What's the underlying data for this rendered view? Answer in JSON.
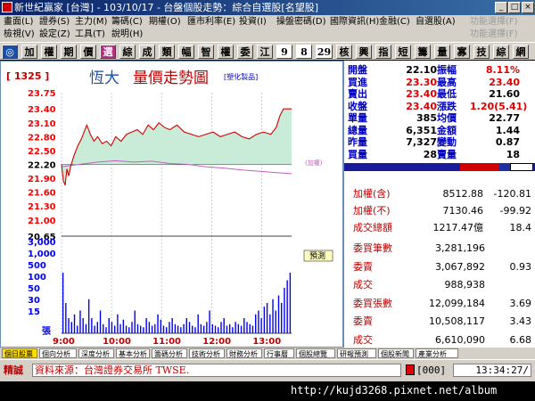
{
  "window": {
    "title": "新世紀贏家 [台灣] - 103/10/17 - 台盤個股走勢：綜合自選股[名望股]",
    "controls": [
      "_",
      "□",
      "×"
    ]
  },
  "menu": {
    "row1": [
      "畫面(L)",
      "證券(S)",
      "主力(M)",
      "籌碼(C)",
      "期權(O)",
      "匯市利率(E)",
      "投資(I)",
      "操盤密碼(D)",
      "國際資訊(H)",
      "金融(C)",
      "自選股(A)",
      "功能選擇(F)"
    ],
    "row2": [
      "檢視(V)",
      "設定(Z)",
      "工具(T)",
      "說明(H)"
    ]
  },
  "toolbar": {
    "buttons": [
      {
        "label": "◎",
        "bg": "#1a4ea8",
        "fg": "#ffffff"
      },
      {
        "label": "加",
        "bg": "#d4d0c8",
        "fg": "#000000"
      },
      {
        "label": "權",
        "bg": "#d4d0c8",
        "fg": "#000000"
      },
      {
        "label": "期",
        "bg": "#d4d0c8",
        "fg": "#000000"
      },
      {
        "label": "價",
        "bg": "#d4d0c8",
        "fg": "#000000"
      },
      {
        "label": "選",
        "bg": "#b03080",
        "fg": "#ffffff"
      },
      {
        "label": "綜",
        "bg": "#d4d0c8",
        "fg": "#000000"
      },
      {
        "label": "成",
        "bg": "#d4d0c8",
        "fg": "#000000"
      },
      {
        "label": "類",
        "bg": "#d4d0c8",
        "fg": "#000000"
      },
      {
        "label": "幅",
        "bg": "#d4d0c8",
        "fg": "#000000"
      },
      {
        "label": "智",
        "bg": "#d4d0c8",
        "fg": "#000000"
      },
      {
        "label": "權",
        "bg": "#d4d0c8",
        "fg": "#000000"
      },
      {
        "label": "委",
        "bg": "#d4d0c8",
        "fg": "#000000"
      },
      {
        "label": "江",
        "bg": "#d4d0c8",
        "fg": "#000000"
      },
      {
        "label": "9",
        "bg": "#ffffff",
        "fg": "#000000"
      },
      {
        "label": "8",
        "bg": "#ffffff",
        "fg": "#000000"
      },
      {
        "label": "29",
        "bg": "#ffffff",
        "fg": "#000000"
      },
      {
        "label": "核",
        "bg": "#d4d0c8",
        "fg": "#000000"
      },
      {
        "label": "興",
        "bg": "#d4d0c8",
        "fg": "#000000"
      },
      {
        "label": "指",
        "bg": "#d4d0c8",
        "fg": "#000000"
      },
      {
        "label": "短",
        "bg": "#d4d0c8",
        "fg": "#000000"
      },
      {
        "label": "籌",
        "bg": "#d4d0c8",
        "fg": "#000000"
      },
      {
        "label": "量",
        "bg": "#d4d0c8",
        "fg": "#000000"
      },
      {
        "label": "寡",
        "bg": "#d4d0c8",
        "fg": "#000000"
      },
      {
        "label": "技",
        "bg": "#d4d0c8",
        "fg": "#000000"
      },
      {
        "label": "綜",
        "bg": "#d4d0c8",
        "fg": "#000000"
      },
      {
        "label": "網",
        "bg": "#d4d0c8",
        "fg": "#000000"
      }
    ]
  },
  "chart_header": {
    "code": "[ 1325 ]",
    "name": "恆大",
    "title": "量價走勢圖",
    "category": "[塑化製品]",
    "note": "(加權)",
    "badge": "預測"
  },
  "chart_data": {
    "type": "line",
    "price_ticks": [
      "23.75",
      "23.40",
      "23.10",
      "22.80",
      "22.50",
      "22.20",
      "21.90",
      "21.60",
      "21.30",
      "21.00",
      "20.65"
    ],
    "volume_ticks": [
      "3,000",
      "1,000",
      "500",
      "100",
      "50",
      "30",
      "15"
    ],
    "volume_unit": "張",
    "time_ticks": [
      "9:00",
      "10:00",
      "11:00",
      "12:00",
      "13:00"
    ],
    "reference_price": 22.2,
    "ylim": [
      20.65,
      23.75
    ],
    "price_series": [
      {
        "t": 0,
        "v": 22.2
      },
      {
        "t": 2,
        "v": 21.85
      },
      {
        "t": 4,
        "v": 21.75
      },
      {
        "t": 6,
        "v": 22.1
      },
      {
        "t": 8,
        "v": 21.95
      },
      {
        "t": 10,
        "v": 22.15
      },
      {
        "t": 14,
        "v": 22.4
      },
      {
        "t": 18,
        "v": 22.6
      },
      {
        "t": 22,
        "v": 22.75
      },
      {
        "t": 25,
        "v": 22.9
      },
      {
        "t": 28,
        "v": 23.05
      },
      {
        "t": 32,
        "v": 22.85
      },
      {
        "t": 36,
        "v": 22.7
      },
      {
        "t": 40,
        "v": 22.8
      },
      {
        "t": 45,
        "v": 22.65
      },
      {
        "t": 50,
        "v": 22.7
      },
      {
        "t": 55,
        "v": 22.6
      },
      {
        "t": 60,
        "v": 22.8
      },
      {
        "t": 66,
        "v": 22.7
      },
      {
        "t": 72,
        "v": 22.85
      },
      {
        "t": 78,
        "v": 22.9
      },
      {
        "t": 84,
        "v": 22.95
      },
      {
        "t": 90,
        "v": 22.85
      },
      {
        "t": 96,
        "v": 23.05
      },
      {
        "t": 102,
        "v": 22.95
      },
      {
        "t": 108,
        "v": 23.1
      },
      {
        "t": 114,
        "v": 23.0
      },
      {
        "t": 120,
        "v": 22.95
      },
      {
        "t": 128,
        "v": 23.05
      },
      {
        "t": 136,
        "v": 22.9
      },
      {
        "t": 144,
        "v": 22.85
      },
      {
        "t": 152,
        "v": 22.8
      },
      {
        "t": 160,
        "v": 22.85
      },
      {
        "t": 168,
        "v": 22.9
      },
      {
        "t": 176,
        "v": 22.8
      },
      {
        "t": 184,
        "v": 22.85
      },
      {
        "t": 192,
        "v": 22.9
      },
      {
        "t": 200,
        "v": 22.8
      },
      {
        "t": 208,
        "v": 22.75
      },
      {
        "t": 216,
        "v": 22.85
      },
      {
        "t": 224,
        "v": 22.9
      },
      {
        "t": 232,
        "v": 22.85
      },
      {
        "t": 238,
        "v": 23.0
      },
      {
        "t": 242,
        "v": 23.25
      },
      {
        "t": 246,
        "v": 23.4
      },
      {
        "t": 255,
        "v": 23.4
      }
    ],
    "index_series": [
      {
        "t": 0,
        "v": 22.15
      },
      {
        "t": 20,
        "v": 22.2
      },
      {
        "t": 40,
        "v": 22.25
      },
      {
        "t": 60,
        "v": 22.28
      },
      {
        "t": 80,
        "v": 22.25
      },
      {
        "t": 100,
        "v": 22.27
      },
      {
        "t": 120,
        "v": 22.22
      },
      {
        "t": 140,
        "v": 22.2
      },
      {
        "t": 160,
        "v": 22.15
      },
      {
        "t": 180,
        "v": 22.12
      },
      {
        "t": 200,
        "v": 22.08
      },
      {
        "t": 220,
        "v": 22.05
      },
      {
        "t": 240,
        "v": 22.02
      },
      {
        "t": 255,
        "v": 22.0
      }
    ],
    "volume_series": [
      80,
      40,
      20,
      15,
      25,
      10,
      30,
      20,
      12,
      45,
      20,
      10,
      15,
      30,
      12,
      8,
      20,
      15,
      10,
      25,
      12,
      18,
      10,
      8,
      15,
      30,
      12,
      10,
      8,
      20,
      15,
      10,
      12,
      25,
      18,
      10,
      8,
      15,
      20,
      12,
      10,
      8,
      12,
      20,
      15,
      10,
      8,
      25,
      12,
      10,
      15,
      30,
      12,
      10,
      8,
      15,
      20,
      10,
      12,
      8,
      15,
      12,
      10,
      20,
      15,
      12,
      10,
      25,
      30,
      20,
      35,
      40,
      25,
      45,
      30,
      50,
      40,
      60,
      70,
      80
    ]
  },
  "quote": {
    "rows": [
      {
        "l1": "開盤",
        "v1": "22.10",
        "l2": "振幅",
        "v2": "8.11%",
        "c1": "#000000",
        "c2": "#e00000"
      },
      {
        "l1": "買進",
        "v1": "23.30",
        "l2": "最高",
        "v2": "23.40",
        "c1": "#e00000",
        "c2": "#e00000"
      },
      {
        "l1": "賣出",
        "v1": "23.40",
        "l2": "最低",
        "v2": "21.60",
        "c1": "#e00000",
        "c2": "#000000"
      },
      {
        "l1": "收盤",
        "v1": "23.40",
        "l2": "漲跌",
        "v2": "1.20(5.41)",
        "c1": "#e00000",
        "c2": "#e00000"
      },
      {
        "l1": "單量",
        "v1": "385",
        "l2": "均價",
        "v2": "22.77",
        "c1": "#000000",
        "c2": "#000000"
      },
      {
        "l1": "總量",
        "v1": "6,351",
        "l2": "金額",
        "v2": "1.44",
        "c1": "#000000",
        "c2": "#000000"
      },
      {
        "l1": "昨量",
        "v1": "7,327",
        "l2": "變動",
        "v2": "0.87",
        "c1": "#000000",
        "c2": "#000000"
      },
      {
        "l1": "買量",
        "v1": "28",
        "l2": "賣量",
        "v2": "18",
        "c1": "#000000",
        "c2": "#000000"
      }
    ],
    "index_rows": [
      {
        "label": "加權(含)",
        "value": "8512.88",
        "change": "-120.81"
      },
      {
        "label": "加權(不)",
        "value": "7130.46",
        "change": "-99.92"
      },
      {
        "label": "成交總額",
        "value": "1217.47億",
        "change": "18.4"
      }
    ],
    "breadth_rows": [
      {
        "label": "委買筆數",
        "value": "3,281,196",
        "ratio": ""
      },
      {
        "label": "委賣",
        "value": "3,067,892",
        "ratio": "0.93"
      },
      {
        "label": "成交",
        "value": "988,938",
        "ratio": ""
      },
      {
        "label": "委買張數",
        "value": "12,099,184",
        "ratio": "3.69"
      },
      {
        "label": "委賣",
        "value": "10,508,117",
        "ratio": "3.43"
      },
      {
        "label": "成交",
        "value": "6,610,090",
        "ratio": "6.68"
      }
    ]
  },
  "tabs": [
    "個日股票",
    "個向分析",
    "深度分析",
    "基本分析",
    "籌碼分析",
    "技術分析",
    "財務分析",
    "行事曆",
    "個股總覽",
    "研報預測",
    "個股新聞",
    "產業分析"
  ],
  "status": {
    "brand": "精誠",
    "source": "資料來源：台灣證券交易所 TWSE.",
    "counter": "[000]",
    "time": "13:34:27/"
  },
  "watermark": "http://kujd3268.pixnet.net/album",
  "colors": {
    "price_line": "#d00000",
    "fill": "#c8ecd8",
    "index_line": "#c060c0",
    "volume": "#0000ff",
    "axis_text": "#ff0000",
    "name_text": "#c00000",
    "title_blue": "#0000c0"
  }
}
